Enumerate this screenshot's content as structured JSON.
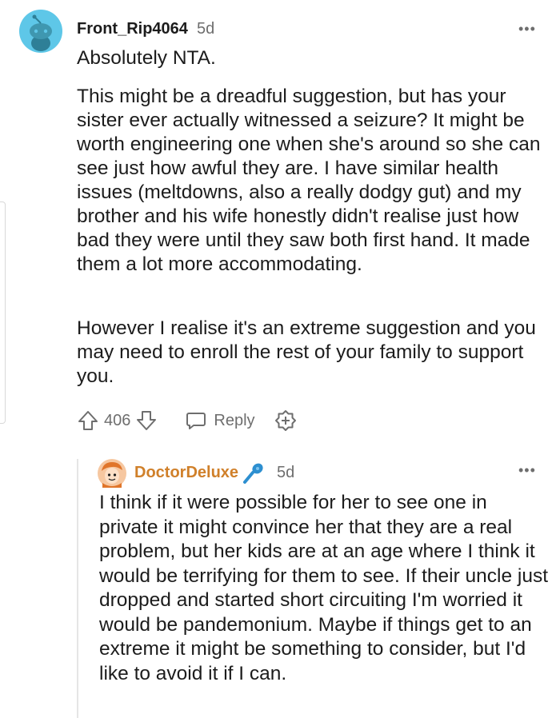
{
  "comment": {
    "username": "Front_Rip4064",
    "age": "5d",
    "more_glyph": "•••",
    "paragraphs": [
      "Absolutely NTA.",
      "This might be a dreadful suggestion, but has your sister ever actually witnessed a seizure? It might be worth engineering one when she's around so she can see just how awful they are. I have similar health issues (meltdowns, also a really dodgy gut) and my brother and his wife honestly didn't realise just how bad they were until they saw both first hand. It made them a lot more accommodating.",
      "However I realise it's an extreme suggestion and you may need to enroll the rest of your family to support you."
    ],
    "votes": "406",
    "reply_label": "Reply"
  },
  "reply": {
    "username": "DoctorDeluxe",
    "username_color": "#d0802a",
    "age": "5d",
    "more_glyph": "•••",
    "text": "I think if it were possible for her to see one in private it might convince her that they are a real problem, but her kids are at an age where I think it would be terrifying for them to see. If their uncle just dropped and started short circuiting I'm worried it would be pandemonium. Maybe if things get to an extreme it might be something to consider, but I'd like to avoid it if I can."
  },
  "colors": {
    "meta_gray": "#6e6e6e",
    "avatar_bg": "#5ec7e8",
    "mic_blue": "#2d8fd0"
  }
}
